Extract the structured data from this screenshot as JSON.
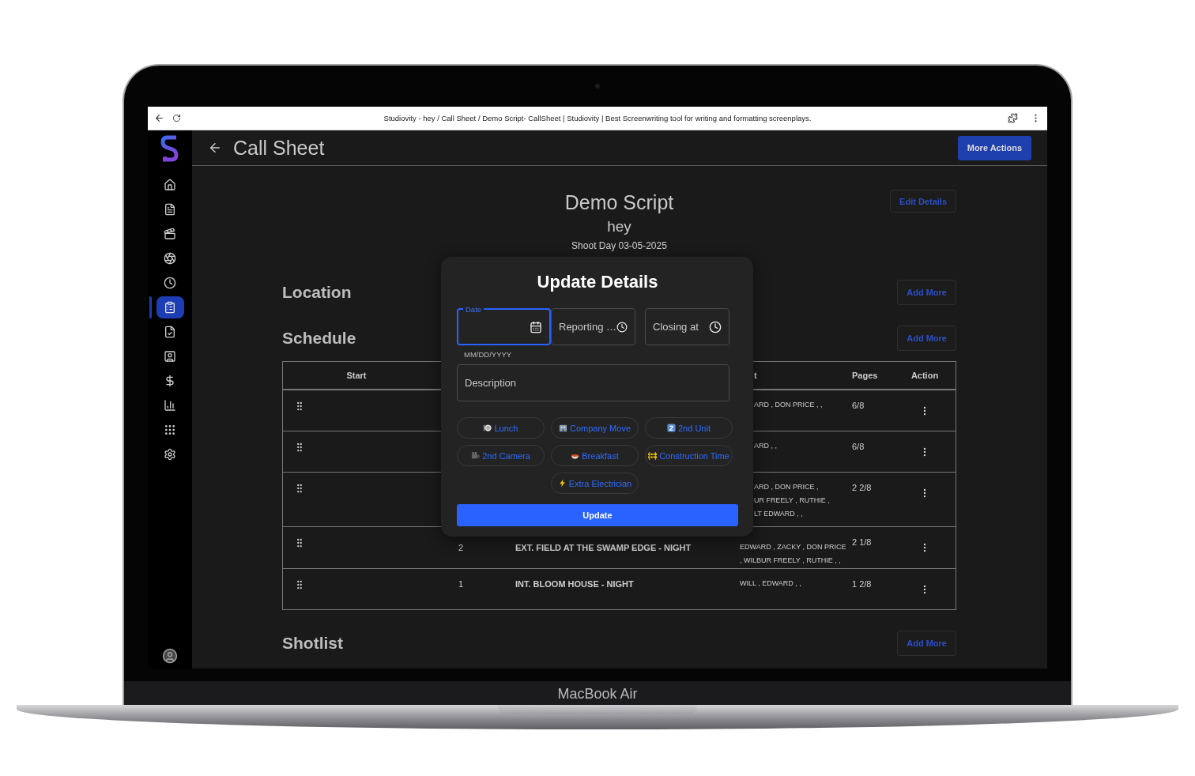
{
  "device": {
    "label": "MacBook Air"
  },
  "browser": {
    "title": "Studiovity - hey / Call Sheet / Demo Script- CallSheet | Studiovity | Best Screenwriting tool for writing and formatting screenplays."
  },
  "sidebar": {
    "items": [
      {
        "kind": "home",
        "selected": false
      },
      {
        "kind": "document",
        "selected": false
      },
      {
        "kind": "clapper",
        "selected": false
      },
      {
        "kind": "aperture",
        "selected": false
      },
      {
        "kind": "clock",
        "selected": false
      },
      {
        "kind": "clipboard",
        "selected": true
      },
      {
        "kind": "file-check",
        "selected": false
      },
      {
        "kind": "contact",
        "selected": false
      },
      {
        "kind": "dollar",
        "selected": false
      },
      {
        "kind": "chart",
        "selected": false
      },
      {
        "kind": "grid",
        "selected": false
      },
      {
        "kind": "settings",
        "selected": false
      }
    ]
  },
  "header": {
    "title": "Call Sheet",
    "action": "More Actions"
  },
  "script": {
    "title": "Demo Script",
    "subtitle": "hey",
    "shoot_day": "Shoot Day 03-05-2025",
    "edit_button": "Edit Details"
  },
  "sections": [
    {
      "title": "Location",
      "button": "Add More"
    },
    {
      "title": "Schedule",
      "button": "Add More"
    }
  ],
  "schedule_table": {
    "columns": {
      "start": "Start",
      "column_4": "t",
      "pages": "Pages",
      "action": "Action"
    },
    "rows": [
      {
        "cast_lines": [
          "ARD , DON PRICE , ,"
        ],
        "pages": "6/8"
      },
      {
        "cast_lines": [
          "ARD , ,"
        ],
        "pages": "6/8"
      },
      {
        "cast_lines": [
          "ARD , DON PRICE ,",
          "UR FREELY , RUTHIE ,",
          "LT EDWARD , ,"
        ],
        "pages": "2 2/8"
      },
      {
        "number": "2",
        "scene": "EXT. FIELD AT THE SWAMP EDGE - NIGHT",
        "cast_lines": [
          "EDWARD , ZACKY , DON PRICE",
          ", WILBUR FREELY , RUTHIE , ,"
        ],
        "pages": "2 1/8"
      },
      {
        "number": "1",
        "scene": "INT. BLOOM HOUSE - NIGHT",
        "cast_lines": [
          "WILL , EDWARD , ,"
        ],
        "pages": "1 2/8"
      }
    ]
  },
  "shotlist": {
    "title": "Shotlist",
    "button": "Add More"
  },
  "dialog": {
    "title": "Update Details",
    "fields": [
      {
        "kind": "date",
        "label": "Date",
        "helper": "MM/DD/YYYY",
        "focused": true
      },
      {
        "kind": "time",
        "label": "Reporting …",
        "focused": false
      },
      {
        "kind": "time",
        "label": "Closing at",
        "focused": false
      }
    ],
    "description": {
      "placeholder": "Description"
    },
    "chips": [
      {
        "kind": "plate",
        "label": "Lunch"
      },
      {
        "kind": "building",
        "label": "Company Move"
      },
      {
        "kind": "keycap",
        "label": "2nd Unit"
      },
      {
        "kind": "camera",
        "label": "2nd Camera"
      },
      {
        "kind": "bowl",
        "label": "Breakfast"
      },
      {
        "kind": "barrier",
        "label": "Construction Time"
      },
      {
        "kind": "bolt",
        "label": "Extra Electrician"
      }
    ],
    "submit": "Update"
  }
}
